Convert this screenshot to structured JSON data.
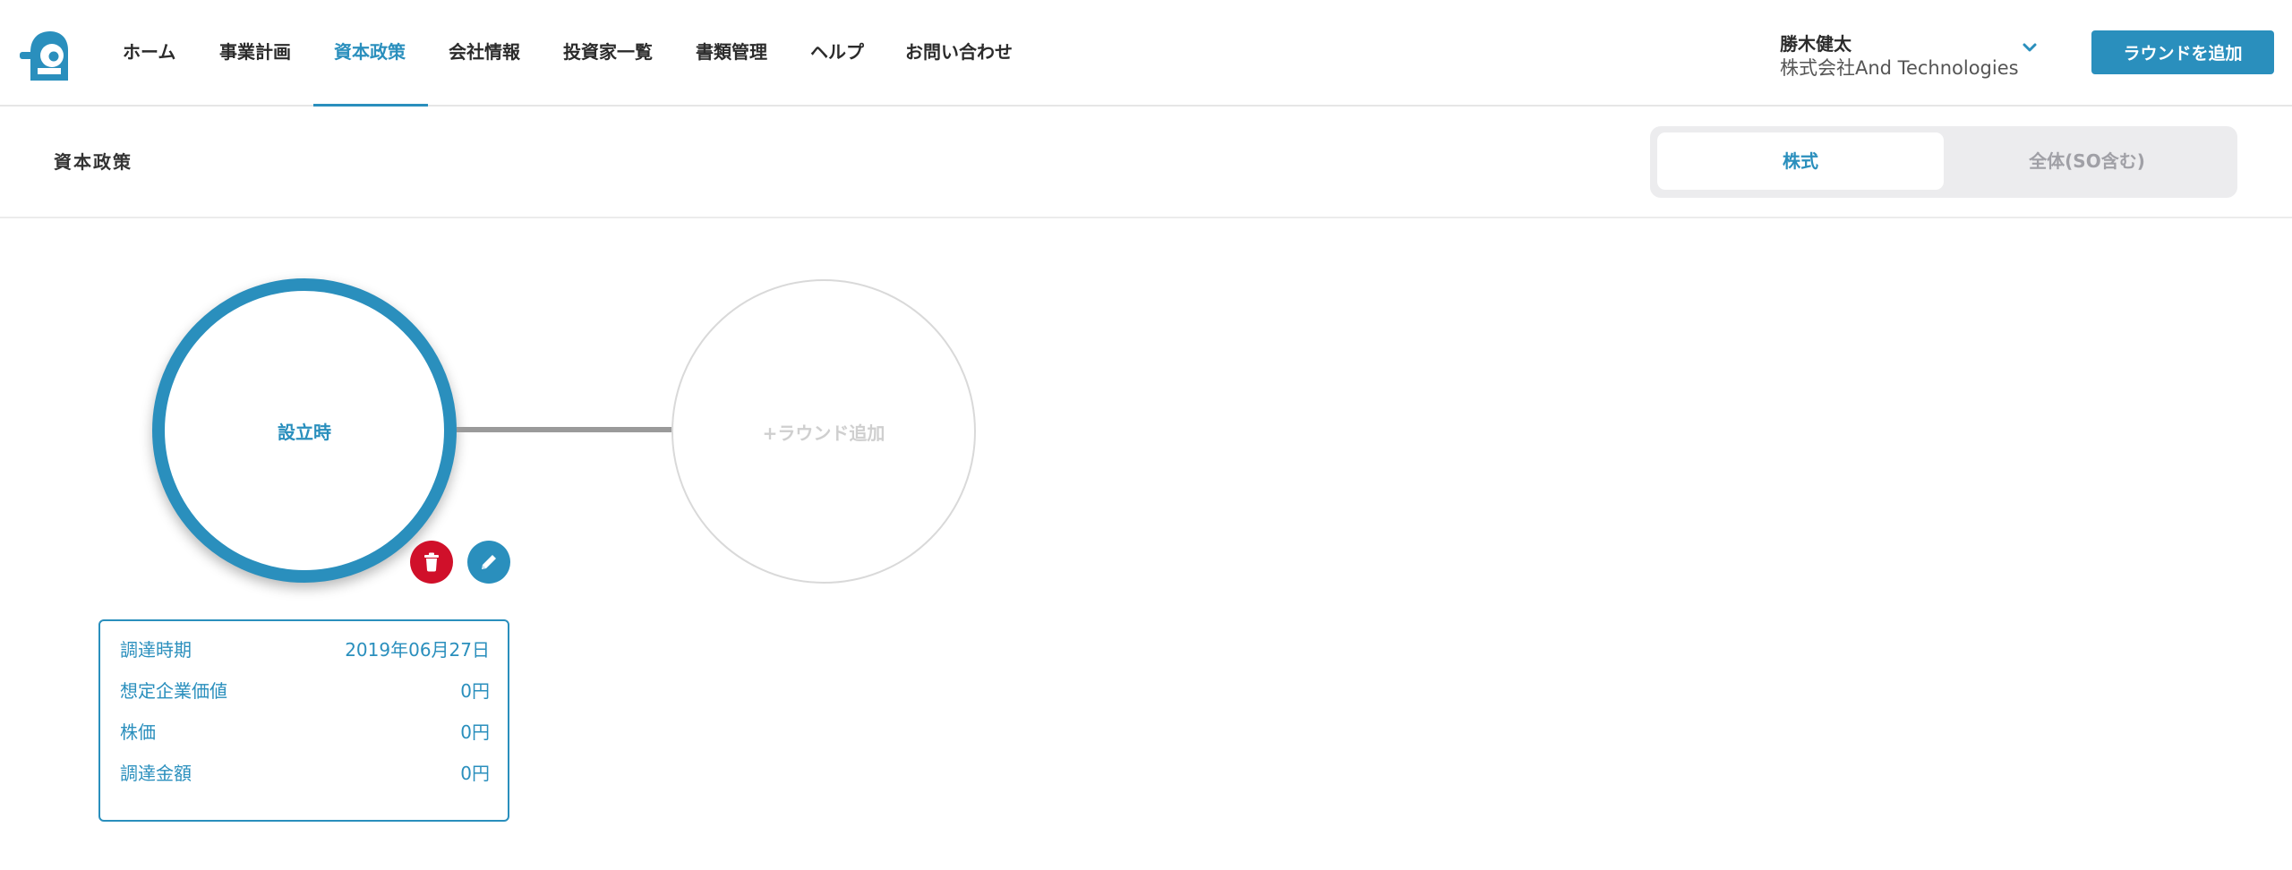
{
  "header": {
    "nav": [
      {
        "label": "ホーム"
      },
      {
        "label": "事業計画"
      },
      {
        "label": "資本政策"
      },
      {
        "label": "会社情報"
      },
      {
        "label": "投資家一覧"
      },
      {
        "label": "書類管理"
      },
      {
        "label": "ヘルプ"
      },
      {
        "label": "お問い合わせ"
      }
    ],
    "user": {
      "name": "勝木健太",
      "company": "株式会社And Technologies"
    },
    "add_round_label": "ラウンドを追加"
  },
  "subheader": {
    "title": "資本政策",
    "segments": [
      "株式",
      "全体(SO含む)"
    ]
  },
  "rounds": {
    "current_label": "設立時",
    "add_label": "+ラウンド追加"
  },
  "info": {
    "rows": [
      {
        "label": "調達時期",
        "value": "2019年06月27日"
      },
      {
        "label": "想定企業価値",
        "value": "0円"
      },
      {
        "label": "株価",
        "value": "0円"
      },
      {
        "label": "調達金額",
        "value": "0円"
      }
    ]
  },
  "colors": {
    "accent": "#2a8fbd",
    "danger": "#d0102a",
    "muted": "#cfcfcf"
  },
  "icons": [
    "logo-icon",
    "chevron-down-icon",
    "trash-icon",
    "pencil-icon"
  ]
}
